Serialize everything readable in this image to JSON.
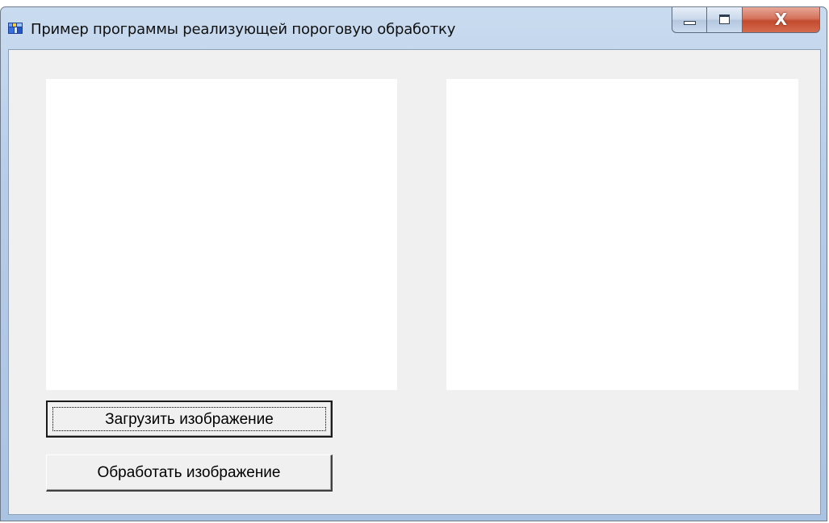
{
  "window": {
    "title": "Пример программы реализующей пороговую обработку",
    "icon": "app-icon",
    "caption_buttons": [
      "minimize-icon",
      "maximize-icon",
      "close-icon"
    ],
    "close_glyph": "X"
  },
  "main": {
    "source_image_panel": "image-box",
    "result_image_panel": "image-box",
    "buttons": {
      "load_label": "Загрузить изображение",
      "process_label": "Обработать изображение"
    }
  },
  "colors": {
    "client_background": "#f0f0f0",
    "image_background": "#ffffff",
    "close_button": "#c24a2e"
  }
}
